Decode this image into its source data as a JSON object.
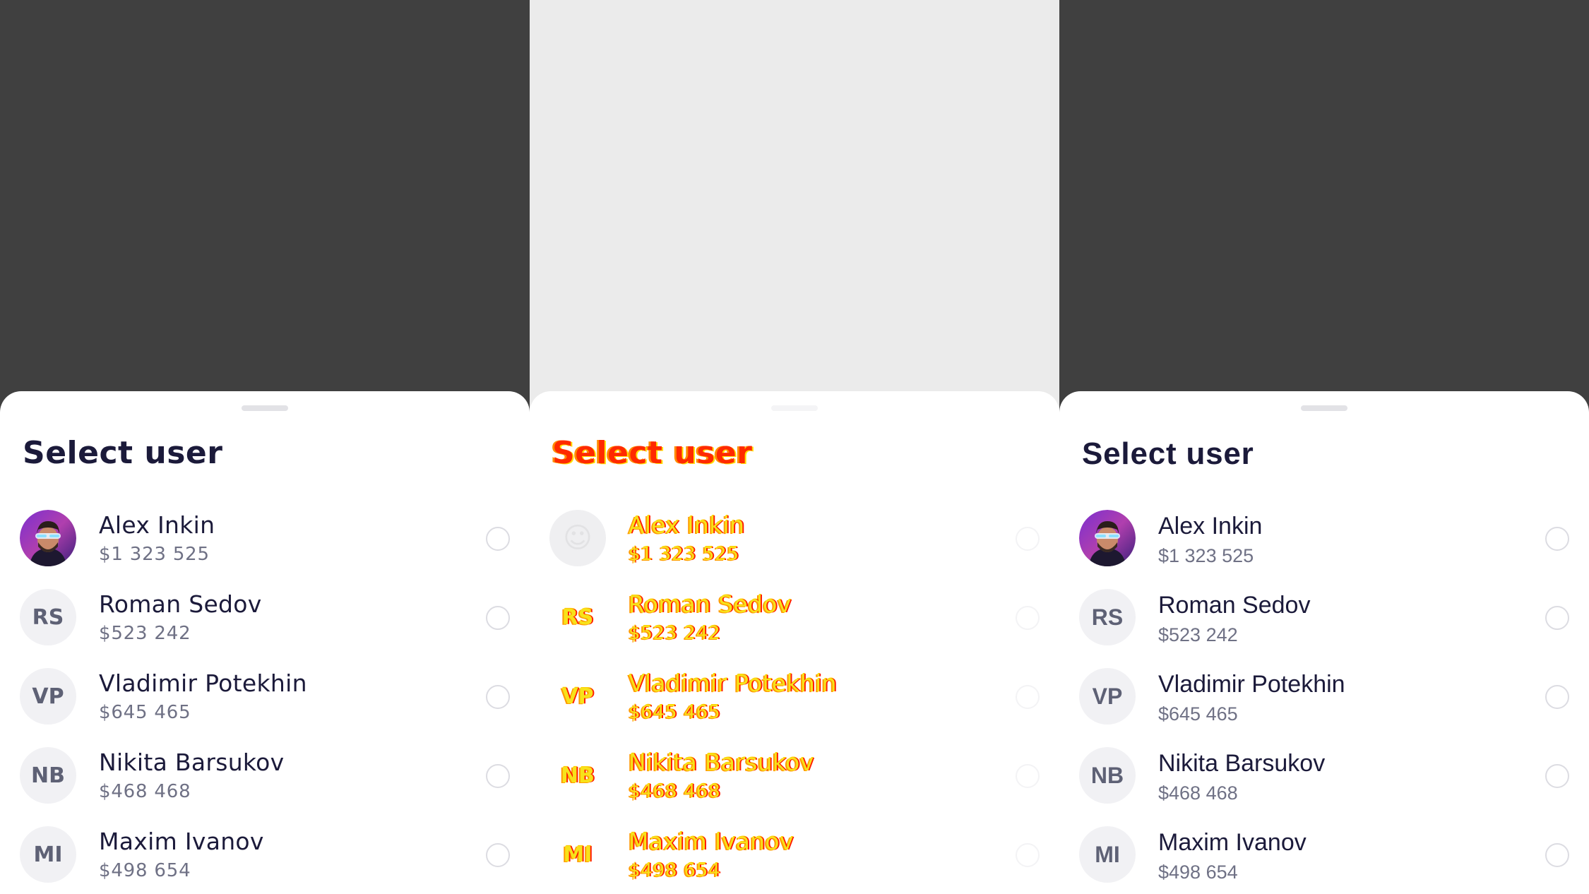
{
  "title": "Select user",
  "users": [
    {
      "name": "Alex Inkin",
      "amount": "$1 323 525",
      "initials": "",
      "has_photo": true
    },
    {
      "name": "Roman Sedov",
      "amount": "$523 242",
      "initials": "RS",
      "has_photo": false
    },
    {
      "name": "Vladimir Potekhin",
      "amount": "$645 465",
      "initials": "VP",
      "has_photo": false
    },
    {
      "name": "Nikita Barsukov",
      "amount": "$468 468",
      "initials": "NB",
      "has_photo": false
    },
    {
      "name": "Maxim Ivanov",
      "amount": "$498 654",
      "initials": "MI",
      "has_photo": false
    }
  ],
  "colors": {
    "backdrop_dark": "#404040",
    "backdrop_light": "#ebebeb",
    "text_primary": "#1b1a3a",
    "text_secondary": "#6f7185",
    "avatar_bg": "#f1f1f4",
    "diff_yellow": "#f7e21a",
    "diff_red": "#ff1a00"
  },
  "icons": {
    "avatar_photo": "user-photo-icon",
    "selector": "radio-unchecked-icon",
    "handle": "drag-handle-icon"
  }
}
